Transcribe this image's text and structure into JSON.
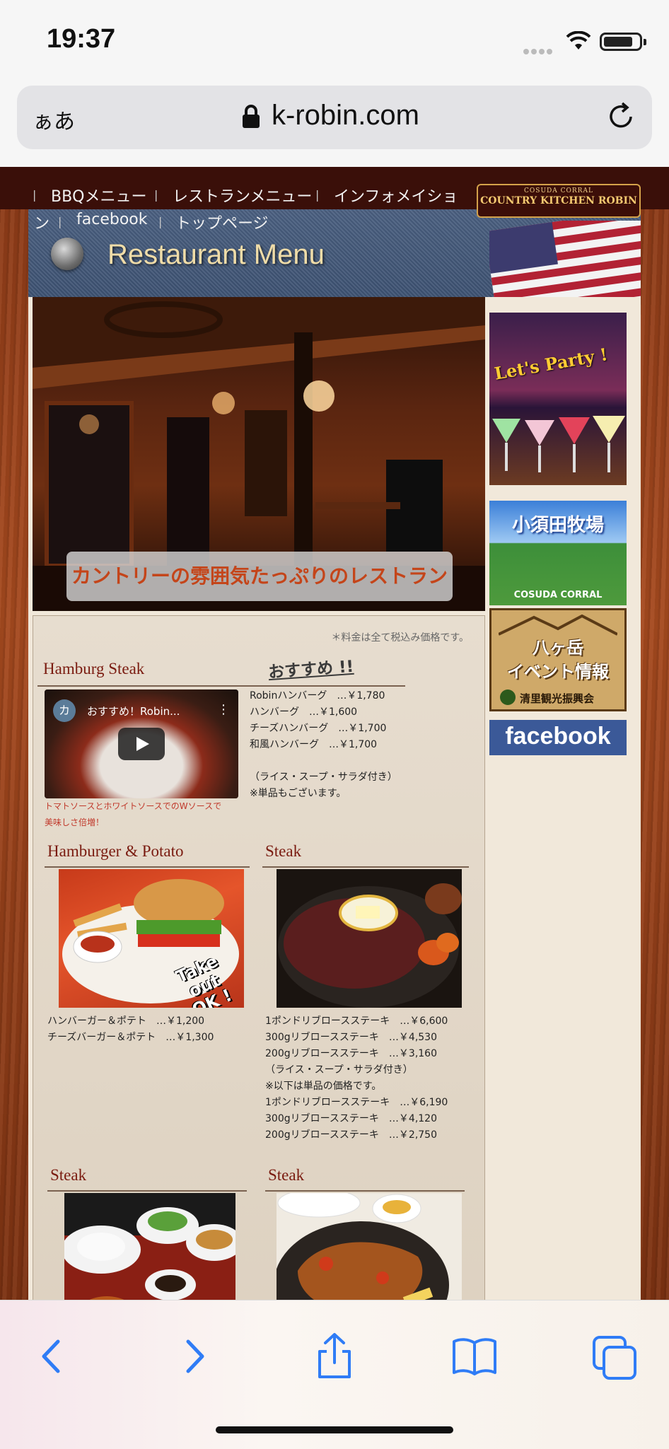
{
  "status": {
    "time": "19:37"
  },
  "addressbar": {
    "text_size": "ぁあ",
    "url": "k-robin.com"
  },
  "site": {
    "nav": {
      "items": [
        "BBQメニュー",
        "レストランメニュー",
        "インフォメイショ",
        "ン",
        "facebook",
        "トップページ"
      ]
    },
    "logo": {
      "top": "COSUDA CORRAL",
      "main": "COUNTRY KITCHEN ROBIN"
    },
    "header": {
      "title": "Restaurant Menu"
    },
    "hero": {
      "caption": "カントリーの雰囲気たっぷりのレストラン"
    },
    "sidebar": {
      "party": "Let's Party !",
      "osuda_title": "小須田牧場",
      "osuda_sub": "COSUDA CORRAL",
      "yatsugatake_line1": "八ヶ岳",
      "yatsugatake_line2": "イベント情報",
      "yatsugatake_org": "清里観光振興会",
      "facebook": "facebook"
    },
    "menu": {
      "note": "＊料金は全て税込み価格です。",
      "hamburg": {
        "title": "Hamburg Steak",
        "recommend": "おすすめ !!",
        "video_avatar": "カ",
        "video_title": "おすすめ！Robin...",
        "items": "Robinハンバーグ　…￥1,780\nハンバーグ　…￥1,600\nチーズハンバーグ　…￥1,700\n和風ハンバーグ　…￥1,700\n\n（ライス・スープ・サラダ付き）\n※単品もございます。",
        "red_note_1": "トマトソースとホワイトソースでのWソースで",
        "red_note_2": "美味しさ倍増！"
      },
      "hamburger": {
        "title": "Hamburger & Potato",
        "badge_1": "Take out",
        "badge_2": "OK !",
        "items": "ハンバーガー＆ポテト　…￥1,200\nチーズバーガー＆ポテト　…￥1,300"
      },
      "steak": {
        "title": "Steak",
        "items": "1ポンドリブロースステーキ　…￥6,600\n300gリブロースステーキ　…￥4,530\n200gリブロースステーキ　…￥3,160\n（ライス・スープ・サラダ付き）\n※以下は単品の価格です。\n1ポンドリブロースステーキ　…￥6,190\n300gリブロースステーキ　…￥4,120\n200gリブロースステーキ　…￥2,750"
      },
      "steak2": {
        "title": "Steak"
      },
      "steak3": {
        "title": "Steak"
      }
    }
  },
  "toolbar": {
    "buttons": [
      "back",
      "forward",
      "share",
      "bookmarks",
      "tabs"
    ]
  },
  "colors": {
    "accent_blue": "#2f7cf6",
    "nav_bg": "#3a0f09",
    "title_red": "#7a1b10"
  }
}
